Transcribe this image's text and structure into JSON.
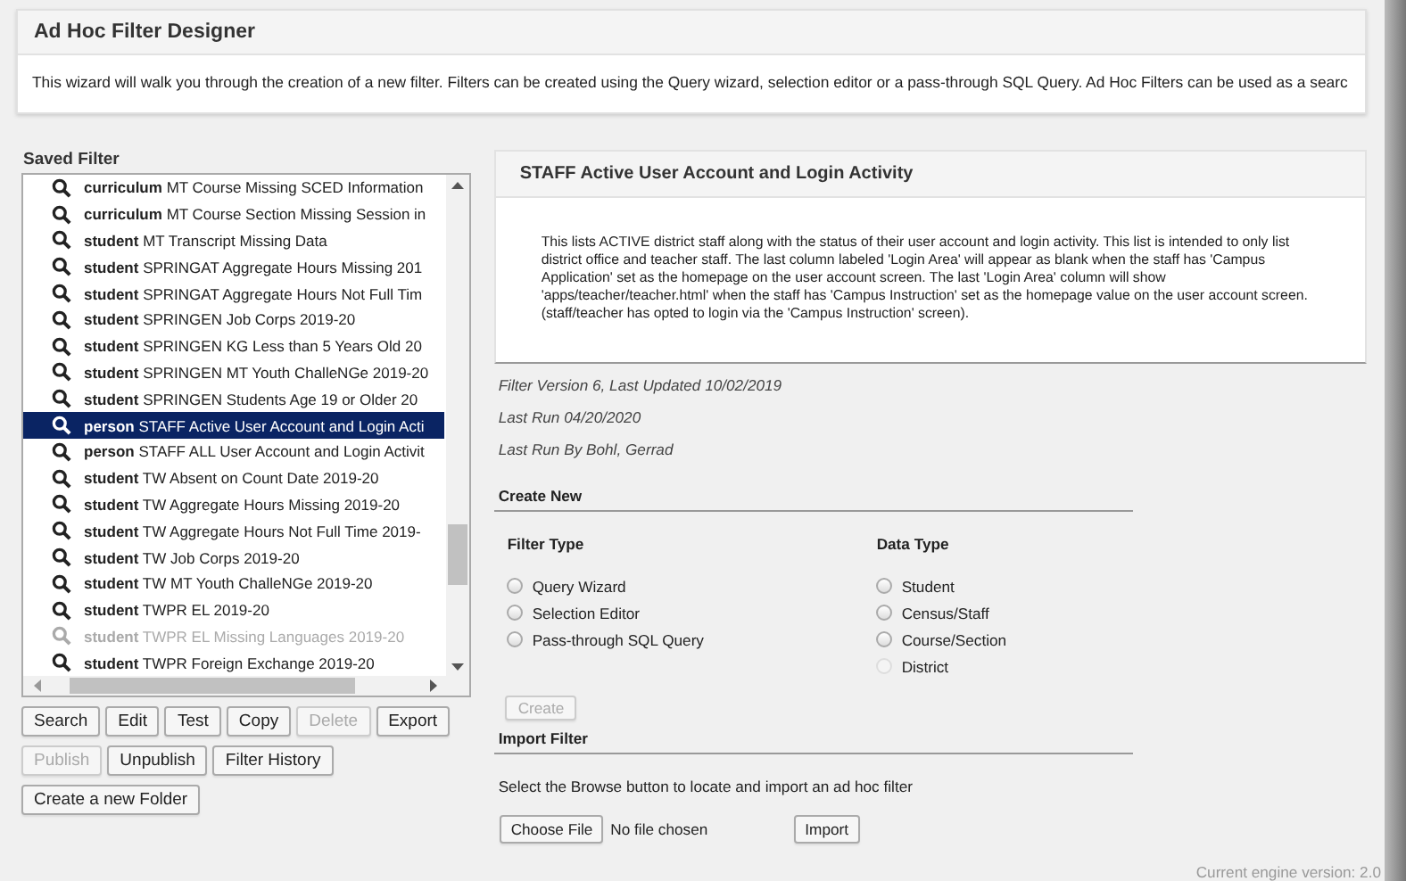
{
  "header": {
    "title": "Ad Hoc Filter Designer",
    "description": "This wizard will walk you through the creation of a new filter. Filters can be created using the Query wizard, selection editor or a pass-through SQL Query. Ad Hoc Filters can be used as a searc"
  },
  "saved_filter": {
    "label": "Saved Filter",
    "items": [
      {
        "type": "curriculum",
        "name": "MT Course Missing SCED Information",
        "selected": false,
        "disabled": false
      },
      {
        "type": "curriculum",
        "name": "MT Course Section Missing Session in",
        "selected": false,
        "disabled": false
      },
      {
        "type": "student",
        "name": "MT Transcript Missing Data",
        "selected": false,
        "disabled": false
      },
      {
        "type": "student",
        "name": "SPRINGAT Aggregate Hours Missing 201",
        "selected": false,
        "disabled": false
      },
      {
        "type": "student",
        "name": "SPRINGAT Aggregate Hours Not Full Tim",
        "selected": false,
        "disabled": false
      },
      {
        "type": "student",
        "name": "SPRINGEN Job Corps 2019-20",
        "selected": false,
        "disabled": false
      },
      {
        "type": "student",
        "name": "SPRINGEN KG Less than 5 Years Old 20",
        "selected": false,
        "disabled": false
      },
      {
        "type": "student",
        "name": "SPRINGEN MT Youth ChalleNGe 2019-20",
        "selected": false,
        "disabled": false
      },
      {
        "type": "student",
        "name": "SPRINGEN Students Age 19 or Older 20",
        "selected": false,
        "disabled": false
      },
      {
        "type": "person",
        "name": "STAFF Active User Account and Login Acti",
        "selected": true,
        "disabled": false
      },
      {
        "type": "person",
        "name": "STAFF ALL User Account and Login Activit",
        "selected": false,
        "disabled": false
      },
      {
        "type": "student",
        "name": "TW Absent on Count Date 2019-20",
        "selected": false,
        "disabled": false
      },
      {
        "type": "student",
        "name": "TW Aggregate Hours Missing 2019-20",
        "selected": false,
        "disabled": false
      },
      {
        "type": "student",
        "name": "TW Aggregate Hours Not Full Time 2019-",
        "selected": false,
        "disabled": false
      },
      {
        "type": "student",
        "name": "TW Job Corps 2019-20",
        "selected": false,
        "disabled": false
      },
      {
        "type": "student",
        "name": "TW MT Youth ChalleNGe 2019-20",
        "selected": false,
        "disabled": false
      },
      {
        "type": "student",
        "name": "TWPR EL 2019-20",
        "selected": false,
        "disabled": false
      },
      {
        "type": "student",
        "name": "TWPR EL Missing Languages 2019-20",
        "selected": false,
        "disabled": true
      },
      {
        "type": "student",
        "name": "TWPR Foreign Exchange 2019-20",
        "selected": false,
        "disabled": false
      }
    ],
    "button_rows": [
      [
        {
          "label": "Search",
          "disabled": false
        },
        {
          "label": "Edit",
          "disabled": false
        },
        {
          "label": "Test",
          "disabled": false
        },
        {
          "label": "Copy",
          "disabled": false
        },
        {
          "label": "Delete",
          "disabled": true
        },
        {
          "label": "Export",
          "disabled": false
        }
      ],
      [
        {
          "label": "Publish",
          "disabled": true
        },
        {
          "label": "Unpublish",
          "disabled": false
        },
        {
          "label": "Filter History",
          "disabled": false
        }
      ],
      [
        {
          "label": "Create a new Folder",
          "disabled": false
        }
      ]
    ]
  },
  "detail": {
    "title": "STAFF Active User Account and Login Activity",
    "description": "This lists ACTIVE district staff along with the status of their user account and login activity.  This list is intended to only list district office and teacher staff.  The last column labeled 'Login Area' will appear as blank when the staff has 'Campus Application' set as the homepage on the user account screen. The last 'Login Area' column will show 'apps/teacher/teacher.html' when the staff has 'Campus Instruction' set as the homepage value on the user account screen. (staff/teacher has opted to login via the 'Campus Instruction' screen).",
    "meta": [
      "Filter Version 6,   Last Updated 10/02/2019",
      "Last Run 04/20/2020",
      "Last Run By Bohl, Gerrad"
    ]
  },
  "create_new": {
    "heading": "Create New",
    "filter_type": {
      "label": "Filter Type",
      "options": [
        {
          "label": "Query Wizard",
          "selected": false,
          "disabled": false
        },
        {
          "label": "Selection Editor",
          "selected": false,
          "disabled": false
        },
        {
          "label": "Pass-through SQL Query",
          "selected": false,
          "disabled": false
        }
      ]
    },
    "data_type": {
      "label": "Data Type",
      "options": [
        {
          "label": "Student",
          "selected": false,
          "disabled": false
        },
        {
          "label": "Census/Staff",
          "selected": false,
          "disabled": false
        },
        {
          "label": "Course/Section",
          "selected": false,
          "disabled": false
        },
        {
          "label": "District",
          "selected": false,
          "disabled": true
        }
      ]
    },
    "create_button": {
      "label": "Create",
      "disabled": true
    }
  },
  "import_filter": {
    "heading": "Import Filter",
    "instructions": "Select the Browse button to locate and import an ad hoc filter",
    "choose_file": "Choose File",
    "file_status": "No file chosen",
    "import_button": "Import"
  },
  "footer": "Current engine version: 2.0"
}
